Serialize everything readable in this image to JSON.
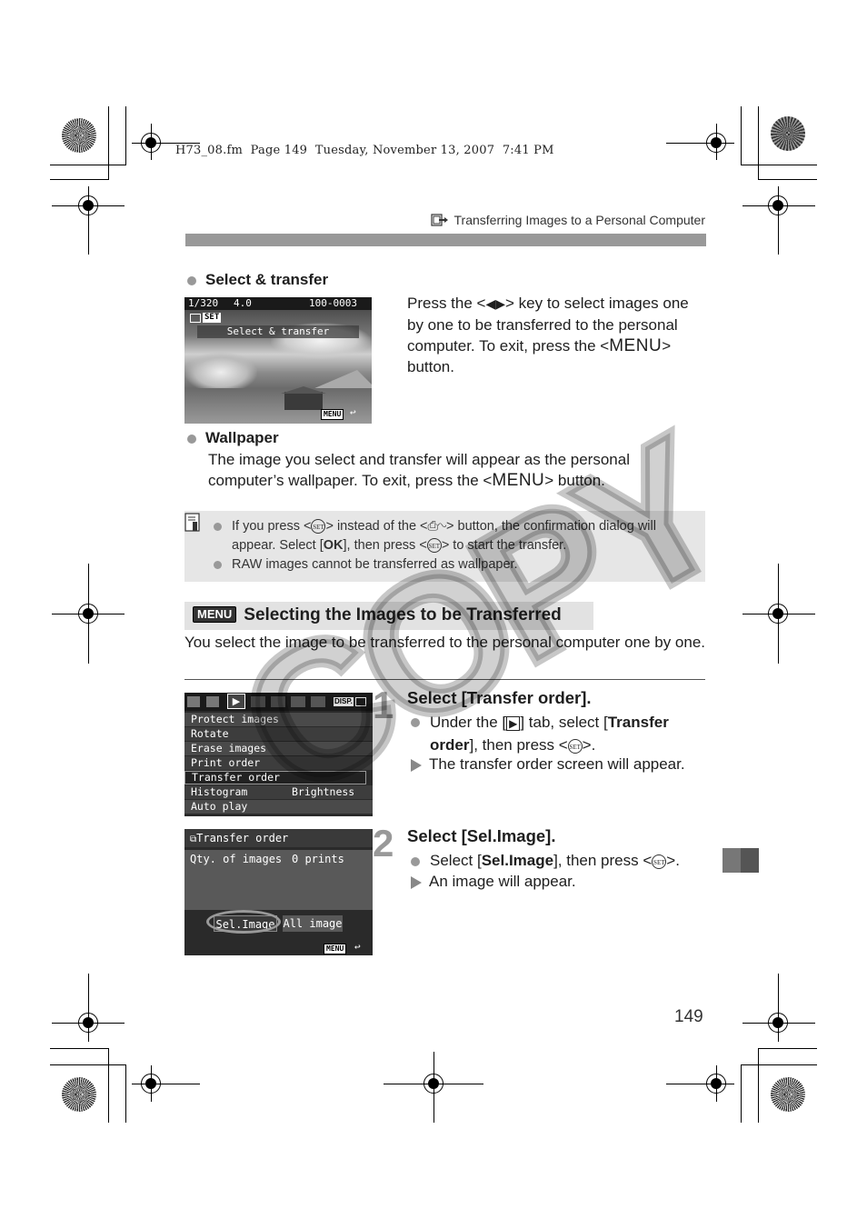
{
  "print_meta": "H73_08.fm  Page 149  Tuesday, November 13, 2007  7:41 PM",
  "running_head": {
    "icon": "transfer-to-pc-icon",
    "title": "Transferring Images to a Personal Computer"
  },
  "select_transfer": {
    "heading": "Select & transfer",
    "lcd": {
      "shutter": "1/320",
      "aperture": "4.0",
      "file_no": "100-0003",
      "set_badge": "SET",
      "banner": "Select & transfer",
      "menu_badge": "MENU",
      "return_glyph": "↩"
    },
    "desc_pre": "Press the <",
    "desc_keys": "◀▶",
    "desc_mid": "> key to select images one by one to be transferred to the personal computer. To exit, press the <",
    "desc_menu": "MENU",
    "desc_post": "> button."
  },
  "wallpaper": {
    "heading": "Wallpaper",
    "text_pre": "The image you select and transfer will appear as the personal computer’s wallpaper. To exit, press the <",
    "text_menu": "MENU",
    "text_post": "> button."
  },
  "note": {
    "icon": "note-icon",
    "items": [
      {
        "p1": "If you press <",
        "set": "SET",
        "p2": "> instead of the <",
        "print_share": "⎙∿",
        "p3": "> button, the confirmation dialog will appear. Select [",
        "ok": "OK",
        "p4": "], then press <",
        "set2": "SET",
        "p5": "> to start the transfer."
      },
      {
        "text": "RAW images cannot be transferred as wallpaper."
      }
    ]
  },
  "section": {
    "badge": "MENU",
    "title": "Selecting the Images to be Transferred",
    "intro": "You select the image to be transferred to the personal computer one by one."
  },
  "step1": {
    "number": "1",
    "title": "Select [Transfer order].",
    "bullet_pre": "Under the [",
    "tab_icon": "▶",
    "bullet_mid": "] tab, select [",
    "bullet_bold": "Transfer order",
    "bullet_post": "], then press <",
    "set": "SET",
    "bullet_end": ">.",
    "result": "The transfer order screen will appear.",
    "lcd": {
      "disp": "DISP.",
      "items": [
        {
          "label": "Protect images",
          "value": ""
        },
        {
          "label": "Rotate",
          "value": ""
        },
        {
          "label": "Erase images",
          "value": ""
        },
        {
          "label": "Print order",
          "value": ""
        },
        {
          "label": "Transfer order",
          "value": "",
          "selected": true
        },
        {
          "label": "Histogram",
          "value": "Brightness"
        },
        {
          "label": "Auto play",
          "value": ""
        }
      ]
    }
  },
  "step2": {
    "number": "2",
    "title": "Select [Sel.Image].",
    "bullet_pre": "Select [",
    "bullet_bold": "Sel.Image",
    "bullet_post": "], then press <",
    "set": "SET",
    "bullet_end": ">.",
    "result": "An image will appear.",
    "lcd": {
      "title": "Transfer order",
      "qty_label": "Qty. of images",
      "qty_value": "0 prints",
      "btn_sel": "Sel.Image",
      "btn_all": "All image",
      "menu_badge": "MENU",
      "return_glyph": "↩"
    }
  },
  "watermark": "COPY",
  "page_number": "149"
}
